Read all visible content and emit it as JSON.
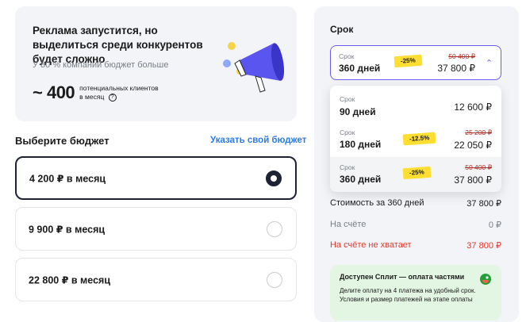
{
  "promo": {
    "title": "Реклама запустится, но выделиться среди конкурентов будет сложно",
    "subtitle": "У 80 % компаний бюджет больше",
    "count": "~ 400",
    "count_caption_line1": "потенциальных клиентов",
    "count_caption_line2": "в месяц",
    "help_icon": "?"
  },
  "budget": {
    "heading": "Выберите бюджет",
    "custom_link": "Указать свой бюджет",
    "options": [
      {
        "label": "4 200 ₽ в месяц",
        "selected": true
      },
      {
        "label": "9 900 ₽ в месяц",
        "selected": false
      },
      {
        "label": "22 800 ₽ в месяц",
        "selected": false
      }
    ]
  },
  "term": {
    "title": "Срок",
    "select": {
      "label": "Срок",
      "value": "360 дней",
      "discount": "-25%",
      "old_price": "50 400 ₽",
      "price": "37 800 ₽"
    },
    "options": [
      {
        "label": "Срок",
        "value": "90 дней",
        "discount": "",
        "old_price": "",
        "price": "12 600 ₽"
      },
      {
        "label": "Срок",
        "value": "180 дней",
        "discount": "-12.5%",
        "old_price": "25 200 ₽",
        "price": "22 050 ₽"
      },
      {
        "label": "Срок",
        "value": "360 дней",
        "discount": "-25%",
        "old_price": "50 400 ₽",
        "price": "37 800 ₽"
      }
    ]
  },
  "summary": {
    "cost_label": "Стоимость за 360 дней",
    "cost_value": "37 800 ₽",
    "balance_label": "На счёте",
    "balance_value": "0 ₽",
    "shortfall_label": "На счёте не хватает",
    "shortfall_value": "37 800 ₽"
  },
  "split": {
    "title": "Доступен Сплит — оплата частями",
    "text": "Делите оплату на 4 платежа на удобный срок. Условия и размер платежей на этапе оплаты",
    "icon": "split-logo-icon"
  },
  "colors": {
    "accent": "#6a5cf6",
    "link": "#2c7be5",
    "discount": "#ffde32",
    "danger": "#e5372b",
    "selected_border": "#1e2235"
  }
}
